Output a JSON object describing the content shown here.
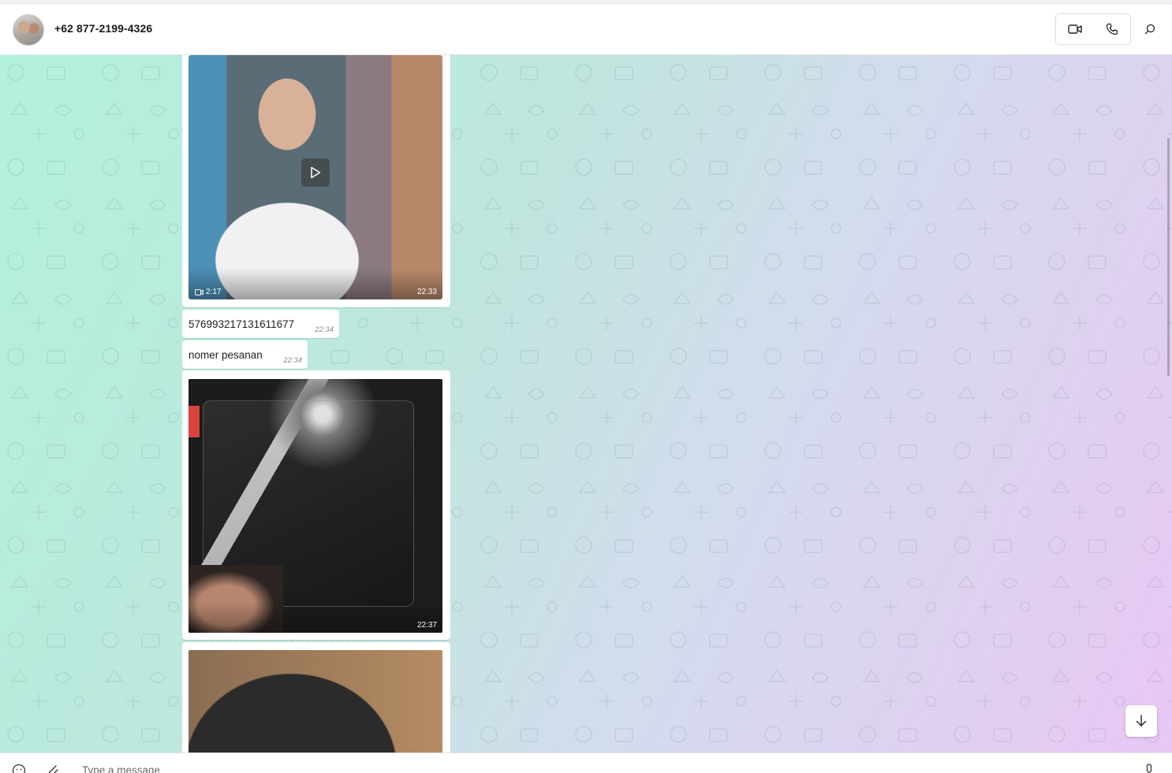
{
  "header": {
    "contact_name": "+62 877-2199-4326",
    "icons": {
      "avatar": "contact-avatar",
      "video": "video-camera-icon",
      "voice": "phone-icon",
      "search": "search-icon"
    }
  },
  "messages": [
    {
      "type": "video",
      "duration": "2:17",
      "time": "22:33"
    },
    {
      "type": "text",
      "text": "576993217131611677",
      "time": "22:34"
    },
    {
      "type": "text",
      "text": "nomer pesanan",
      "time": "22:34"
    },
    {
      "type": "image",
      "time": "22:37"
    },
    {
      "type": "image"
    }
  ],
  "composer": {
    "placeholder": "Type a message",
    "icons": {
      "emoji": "emoji-icon",
      "attach": "paperclip-icon",
      "mic": "microphone-icon"
    }
  },
  "colors": {
    "chat_gradient_start": "#b2f1dd",
    "chat_gradient_end": "#e8c7f4",
    "bubble": "#ffffff"
  }
}
